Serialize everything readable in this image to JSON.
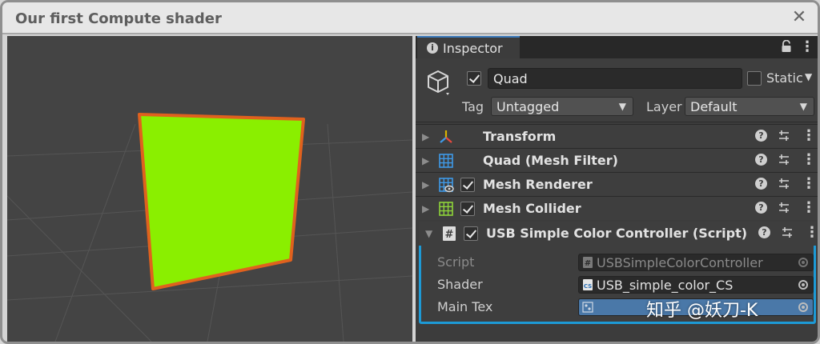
{
  "window": {
    "title": "Our first Compute shader",
    "close_icon": "close-icon"
  },
  "inspector": {
    "tab_label": "Inspector",
    "gameobject": {
      "active": true,
      "name": "Quad",
      "static_label": "Static",
      "static_checked": false,
      "tag_label": "Tag",
      "tag_value": "Untagged",
      "layer_label": "Layer",
      "layer_value": "Default"
    },
    "components": [
      {
        "name": "Transform",
        "icon": "transform-icon",
        "has_checkbox": false
      },
      {
        "name": "Quad (Mesh Filter)",
        "icon": "mesh-filter-icon",
        "has_checkbox": false
      },
      {
        "name": "Mesh Renderer",
        "icon": "mesh-renderer-icon",
        "has_checkbox": true,
        "enabled": true
      },
      {
        "name": "Mesh Collider",
        "icon": "mesh-collider-icon",
        "has_checkbox": true,
        "enabled": true
      }
    ],
    "script_component": {
      "name": "USB Simple Color Controller (Script)",
      "enabled": true,
      "properties": [
        {
          "label": "Script",
          "value": "USBSimpleColorController"
        },
        {
          "label": "Shader",
          "value": "USB_simple_color_CS"
        },
        {
          "label": "Main Tex",
          "value": ""
        }
      ]
    }
  },
  "watermark": "知乎 @妖刀-K",
  "colors": {
    "quad_fill": "#8aef00",
    "quad_outline": "#e0611e",
    "highlight": "#1d9ad6"
  }
}
